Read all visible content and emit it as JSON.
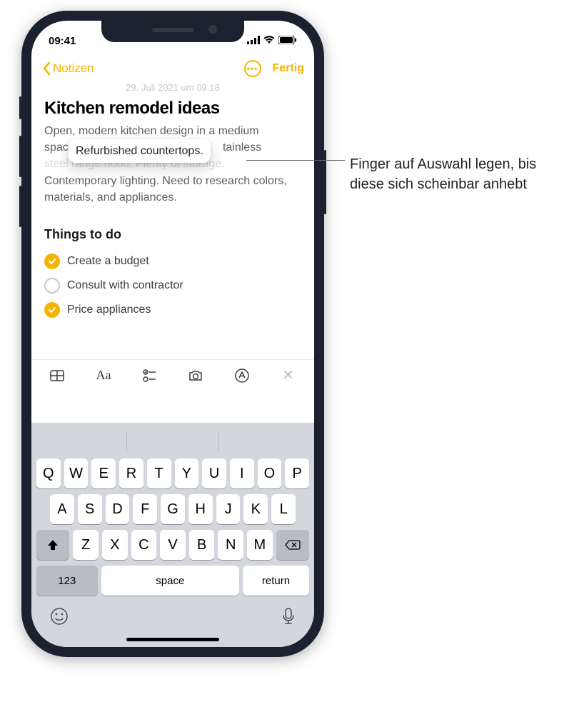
{
  "status": {
    "time": "09:41"
  },
  "nav": {
    "back_label": "Notizen",
    "done_label": "Fertig"
  },
  "date": "29. Juli 2021 um 09:18",
  "note": {
    "title": "Kitchen remodel ideas",
    "body_line1": "Open, modern kitchen design in a medium",
    "body_line2_pre": "space",
    "body_line2_post": "tainless",
    "body_line3": "steel range hood. Plenty of storage.",
    "body_rest": "Contemporary lighting. Need to research colors, materials, and appliances.",
    "floating_selection": "Refurbished countertops.",
    "subhead": "Things to do",
    "todos": [
      {
        "label": "Create a budget",
        "checked": true
      },
      {
        "label": "Consult with contractor",
        "checked": false
      },
      {
        "label": "Price appliances",
        "checked": true
      }
    ]
  },
  "toolbar": {
    "icons": [
      "table-icon",
      "text-format-icon",
      "checklist-icon",
      "camera-icon",
      "markup-icon",
      "close-icon"
    ],
    "aa_label": "Aa"
  },
  "keyboard": {
    "row1": [
      "Q",
      "W",
      "E",
      "R",
      "T",
      "Y",
      "U",
      "I",
      "O",
      "P"
    ],
    "row2": [
      "A",
      "S",
      "D",
      "F",
      "G",
      "H",
      "J",
      "K",
      "L"
    ],
    "row3": [
      "Z",
      "X",
      "C",
      "V",
      "B",
      "N",
      "M"
    ],
    "fn": {
      "num": "123",
      "space": "space",
      "return": "return"
    }
  },
  "callout": {
    "text": "Finger auf Auswahl legen, bis diese sich scheinbar anhebt"
  }
}
